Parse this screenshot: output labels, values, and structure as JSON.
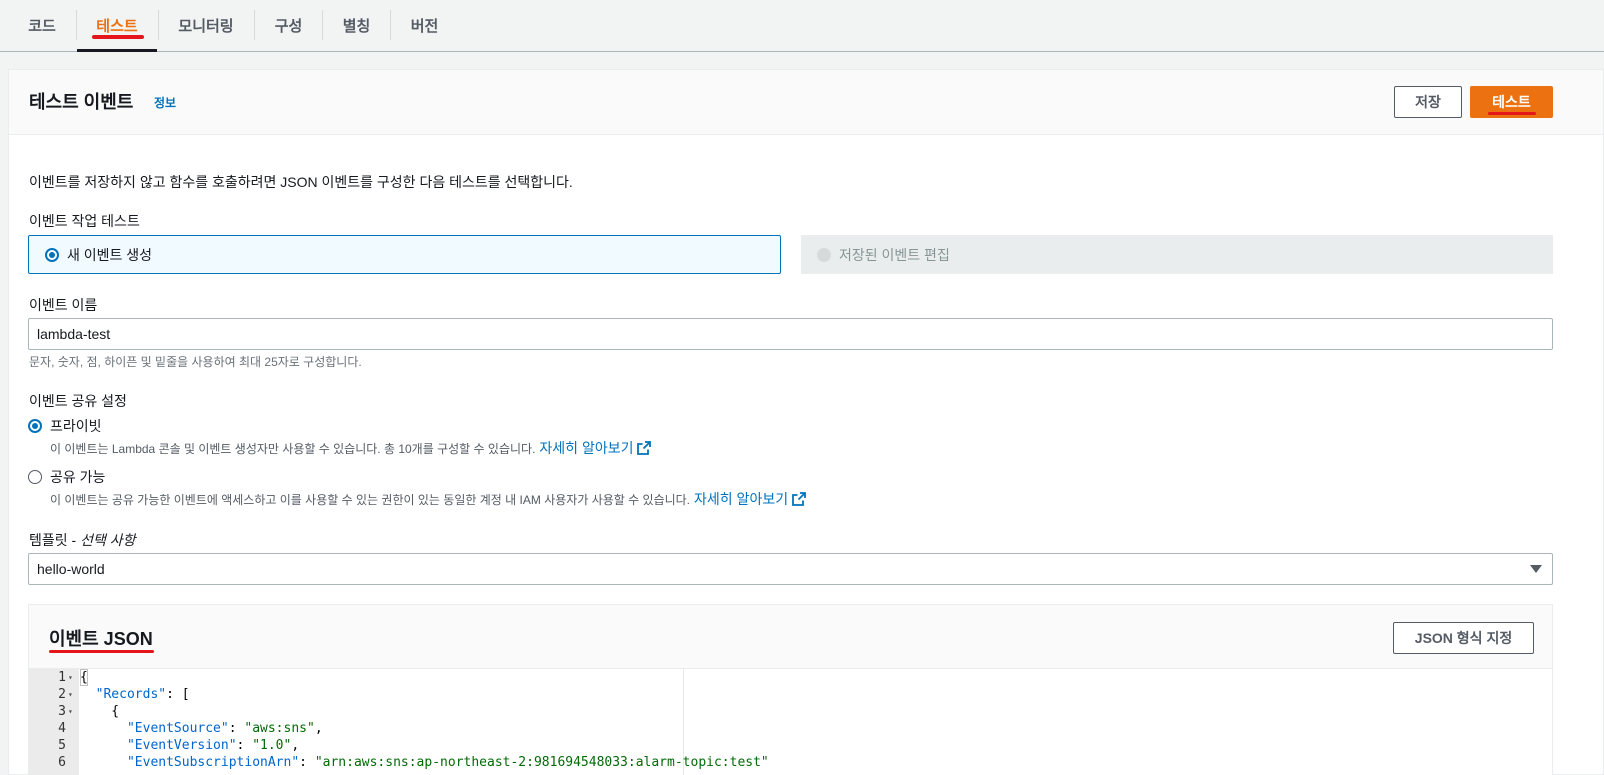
{
  "tabs": [
    "코드",
    "테스트",
    "모니터링",
    "구성",
    "별칭",
    "버전"
  ],
  "active_tab": "테스트",
  "header": {
    "title": "테스트 이벤트",
    "info_link": "정보",
    "save_button": "저장",
    "test_button": "테스트"
  },
  "description": "이벤트를 저장하지 않고 함수를 호출하려면 JSON 이벤트를 구성한 다음 테스트를 선택합니다.",
  "event_action": {
    "label": "이벤트 작업 테스트",
    "option_new": "새 이벤트 생성",
    "option_edit": "저장된 이벤트 편집"
  },
  "event_name": {
    "label": "이벤트 이름",
    "value": "lambda-test",
    "hint": "문자, 숫자, 점, 하이픈 및 밑줄을 사용하여 최대 25자로 구성합니다."
  },
  "sharing": {
    "label": "이벤트 공유 설정",
    "private_label": "프라이빗",
    "private_desc": "이 이벤트는 Lambda 콘솔 및 이벤트 생성자만 사용할 수 있습니다. 총 10개를 구성할 수 있습니다.",
    "shareable_label": "공유 가능",
    "shareable_desc": "이 이벤트는 공유 가능한 이벤트에 액세스하고 이를 사용할 수 있는 권한이 있는 동일한 계정 내 IAM 사용자가 사용할 수 있습니다.",
    "learn_more": "자세히 알아보기"
  },
  "template": {
    "label": "템플릿 - ",
    "label_optional": "선택 사항",
    "value": "hello-world"
  },
  "event_json": {
    "title": "이벤트 JSON",
    "format_button": "JSON 형식 지정",
    "lines": [
      {
        "n": "1",
        "fold": true,
        "text": "{"
      },
      {
        "n": "2",
        "fold": true,
        "indent": "  ",
        "key": "\"Records\"",
        "rest": ": ["
      },
      {
        "n": "3",
        "fold": true,
        "text": "    {"
      },
      {
        "n": "4",
        "fold": false,
        "indent": "      ",
        "key": "\"EventSource\"",
        "rest": ": ",
        "str": "\"aws:sns\"",
        "tail": ","
      },
      {
        "n": "5",
        "fold": false,
        "indent": "      ",
        "key": "\"EventVersion\"",
        "rest": ": ",
        "str": "\"1.0\"",
        "tail": ","
      },
      {
        "n": "6",
        "fold": false,
        "indent": "      ",
        "key": "\"EventSubscriptionArn\"",
        "rest": ": ",
        "str": "\"arn:aws:sns:ap-northeast-2:981694548033:alarm-topic:test\"",
        "tail": ""
      }
    ]
  },
  "colors": {
    "accent": "#ec7211",
    "link": "#0073bb",
    "annotation_red": "#e5161b"
  }
}
